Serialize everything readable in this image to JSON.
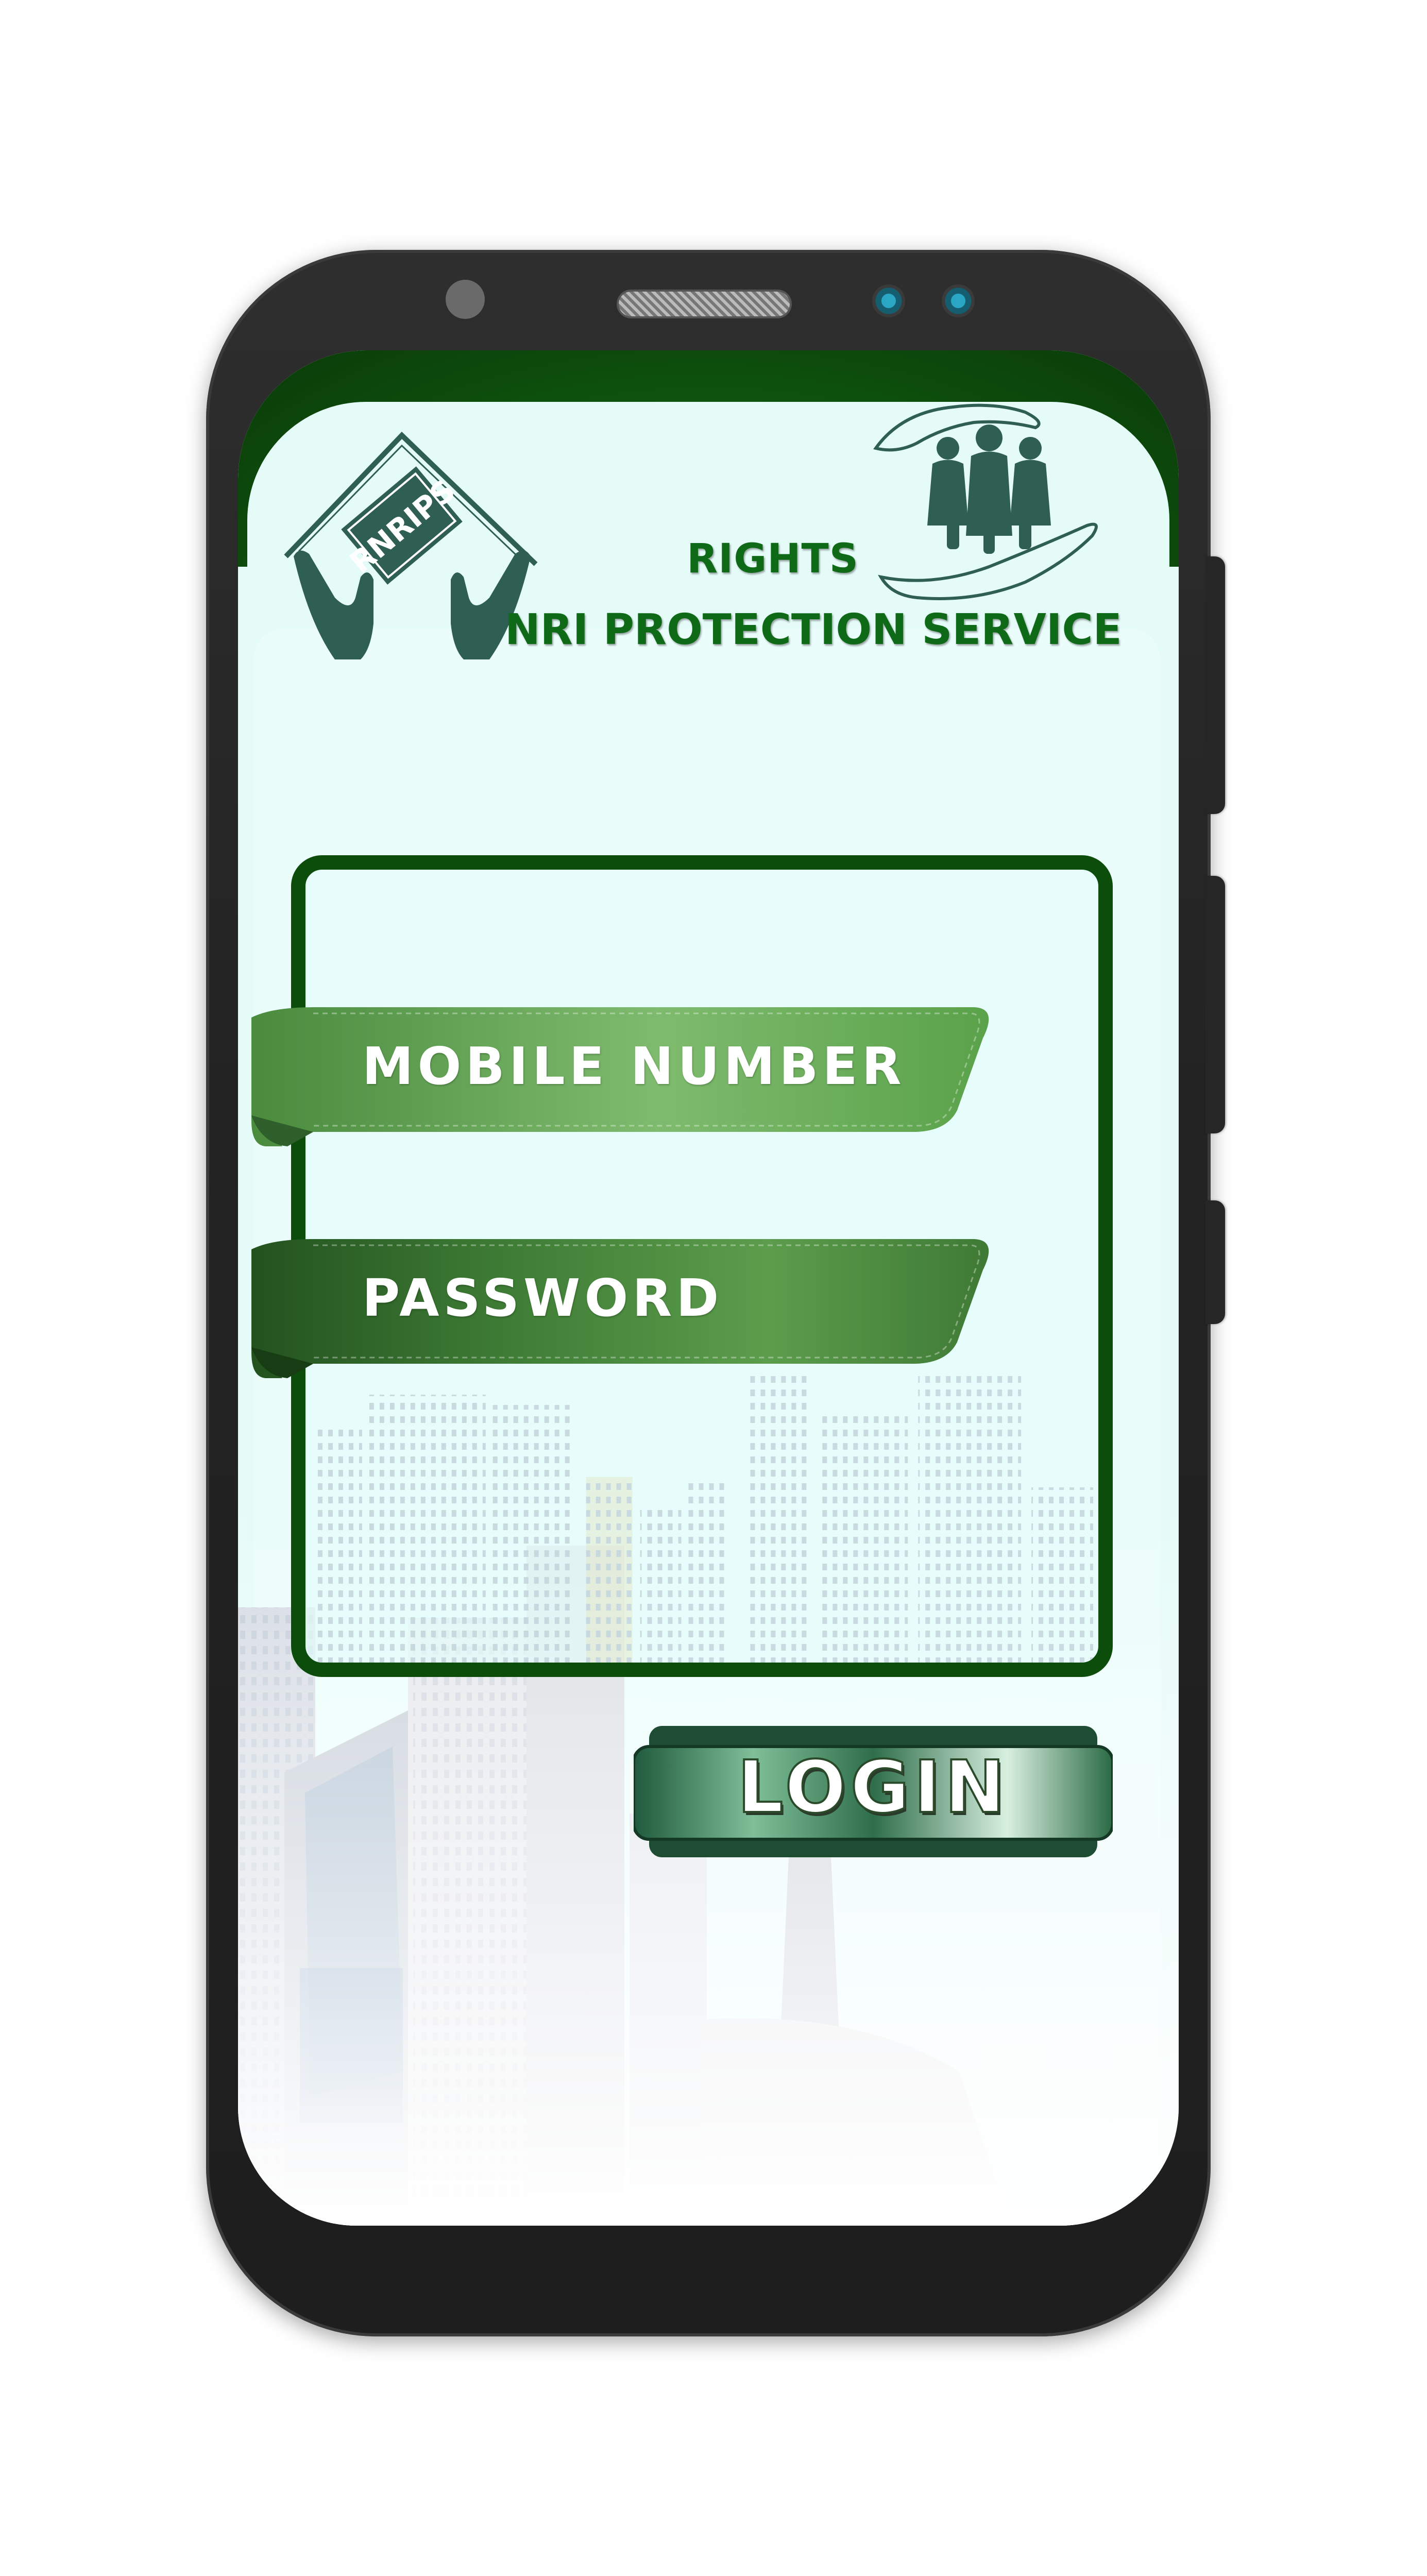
{
  "header": {
    "rights_title": "RIGHTS",
    "service_title": "NRI PROTECTION SERVICE",
    "logo_text": "RNRIPS"
  },
  "form": {
    "mobile_label": "MOBILE NUMBER",
    "password_label": "PASSWORD",
    "login_label": "LOGIN"
  },
  "icons": {
    "logo": "house-hands-logo-icon",
    "family": "family-in-hands-icon"
  },
  "colors": {
    "brand_green": "#0e6a17",
    "dark_green": "#0c4d0c",
    "ribbon_light": "#6fb661",
    "ribbon_dark": "#2f6a2a",
    "screen_bg": "#e6fbf8",
    "phone_body": "#232323"
  }
}
